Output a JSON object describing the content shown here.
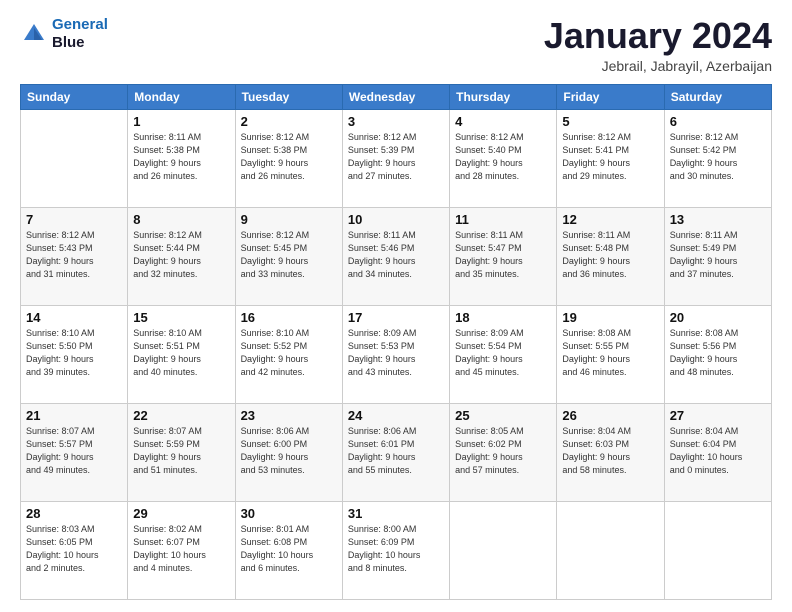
{
  "logo": {
    "line1": "General",
    "line2": "Blue"
  },
  "title": "January 2024",
  "location": "Jebrail, Jabrayil, Azerbaijan",
  "weekdays": [
    "Sunday",
    "Monday",
    "Tuesday",
    "Wednesday",
    "Thursday",
    "Friday",
    "Saturday"
  ],
  "weeks": [
    [
      {
        "day": "",
        "info": ""
      },
      {
        "day": "1",
        "info": "Sunrise: 8:11 AM\nSunset: 5:38 PM\nDaylight: 9 hours\nand 26 minutes."
      },
      {
        "day": "2",
        "info": "Sunrise: 8:12 AM\nSunset: 5:38 PM\nDaylight: 9 hours\nand 26 minutes."
      },
      {
        "day": "3",
        "info": "Sunrise: 8:12 AM\nSunset: 5:39 PM\nDaylight: 9 hours\nand 27 minutes."
      },
      {
        "day": "4",
        "info": "Sunrise: 8:12 AM\nSunset: 5:40 PM\nDaylight: 9 hours\nand 28 minutes."
      },
      {
        "day": "5",
        "info": "Sunrise: 8:12 AM\nSunset: 5:41 PM\nDaylight: 9 hours\nand 29 minutes."
      },
      {
        "day": "6",
        "info": "Sunrise: 8:12 AM\nSunset: 5:42 PM\nDaylight: 9 hours\nand 30 minutes."
      }
    ],
    [
      {
        "day": "7",
        "info": "Sunrise: 8:12 AM\nSunset: 5:43 PM\nDaylight: 9 hours\nand 31 minutes."
      },
      {
        "day": "8",
        "info": "Sunrise: 8:12 AM\nSunset: 5:44 PM\nDaylight: 9 hours\nand 32 minutes."
      },
      {
        "day": "9",
        "info": "Sunrise: 8:12 AM\nSunset: 5:45 PM\nDaylight: 9 hours\nand 33 minutes."
      },
      {
        "day": "10",
        "info": "Sunrise: 8:11 AM\nSunset: 5:46 PM\nDaylight: 9 hours\nand 34 minutes."
      },
      {
        "day": "11",
        "info": "Sunrise: 8:11 AM\nSunset: 5:47 PM\nDaylight: 9 hours\nand 35 minutes."
      },
      {
        "day": "12",
        "info": "Sunrise: 8:11 AM\nSunset: 5:48 PM\nDaylight: 9 hours\nand 36 minutes."
      },
      {
        "day": "13",
        "info": "Sunrise: 8:11 AM\nSunset: 5:49 PM\nDaylight: 9 hours\nand 37 minutes."
      }
    ],
    [
      {
        "day": "14",
        "info": "Sunrise: 8:10 AM\nSunset: 5:50 PM\nDaylight: 9 hours\nand 39 minutes."
      },
      {
        "day": "15",
        "info": "Sunrise: 8:10 AM\nSunset: 5:51 PM\nDaylight: 9 hours\nand 40 minutes."
      },
      {
        "day": "16",
        "info": "Sunrise: 8:10 AM\nSunset: 5:52 PM\nDaylight: 9 hours\nand 42 minutes."
      },
      {
        "day": "17",
        "info": "Sunrise: 8:09 AM\nSunset: 5:53 PM\nDaylight: 9 hours\nand 43 minutes."
      },
      {
        "day": "18",
        "info": "Sunrise: 8:09 AM\nSunset: 5:54 PM\nDaylight: 9 hours\nand 45 minutes."
      },
      {
        "day": "19",
        "info": "Sunrise: 8:08 AM\nSunset: 5:55 PM\nDaylight: 9 hours\nand 46 minutes."
      },
      {
        "day": "20",
        "info": "Sunrise: 8:08 AM\nSunset: 5:56 PM\nDaylight: 9 hours\nand 48 minutes."
      }
    ],
    [
      {
        "day": "21",
        "info": "Sunrise: 8:07 AM\nSunset: 5:57 PM\nDaylight: 9 hours\nand 49 minutes."
      },
      {
        "day": "22",
        "info": "Sunrise: 8:07 AM\nSunset: 5:59 PM\nDaylight: 9 hours\nand 51 minutes."
      },
      {
        "day": "23",
        "info": "Sunrise: 8:06 AM\nSunset: 6:00 PM\nDaylight: 9 hours\nand 53 minutes."
      },
      {
        "day": "24",
        "info": "Sunrise: 8:06 AM\nSunset: 6:01 PM\nDaylight: 9 hours\nand 55 minutes."
      },
      {
        "day": "25",
        "info": "Sunrise: 8:05 AM\nSunset: 6:02 PM\nDaylight: 9 hours\nand 57 minutes."
      },
      {
        "day": "26",
        "info": "Sunrise: 8:04 AM\nSunset: 6:03 PM\nDaylight: 9 hours\nand 58 minutes."
      },
      {
        "day": "27",
        "info": "Sunrise: 8:04 AM\nSunset: 6:04 PM\nDaylight: 10 hours\nand 0 minutes."
      }
    ],
    [
      {
        "day": "28",
        "info": "Sunrise: 8:03 AM\nSunset: 6:05 PM\nDaylight: 10 hours\nand 2 minutes."
      },
      {
        "day": "29",
        "info": "Sunrise: 8:02 AM\nSunset: 6:07 PM\nDaylight: 10 hours\nand 4 minutes."
      },
      {
        "day": "30",
        "info": "Sunrise: 8:01 AM\nSunset: 6:08 PM\nDaylight: 10 hours\nand 6 minutes."
      },
      {
        "day": "31",
        "info": "Sunrise: 8:00 AM\nSunset: 6:09 PM\nDaylight: 10 hours\nand 8 minutes."
      },
      {
        "day": "",
        "info": ""
      },
      {
        "day": "",
        "info": ""
      },
      {
        "day": "",
        "info": ""
      }
    ]
  ]
}
